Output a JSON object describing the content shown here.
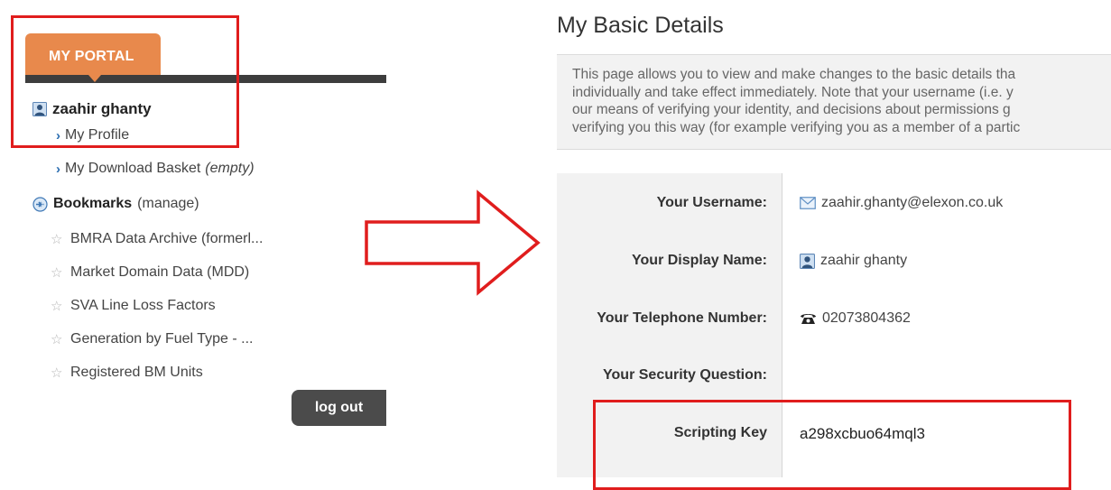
{
  "portal": {
    "tab_label": "MY PORTAL",
    "user_name": "zaahir ghanty",
    "profile_link": "My Profile",
    "download_basket_link": "My Download Basket",
    "download_basket_status": "(empty)",
    "bookmarks_title": "Bookmarks",
    "bookmarks_manage": "(manage)",
    "bookmarks": [
      "BMRA Data Archive (formerl...",
      "Market Domain Data (MDD)",
      "SVA Line Loss Factors",
      "Generation by Fuel Type - ...",
      "Registered BM Units"
    ],
    "logout_label": "log out"
  },
  "details": {
    "title": "My Basic Details",
    "intro_lines": [
      "This page allows you to view and make changes to the basic details tha",
      "individually and take effect immediately. Note that your username (i.e. y",
      "our means of verifying your identity, and decisions about permissions g",
      "verifying you this way (for example verifying you as a member of a partic"
    ],
    "username_label": "Your Username:",
    "username_value": "zaahir.ghanty@elexon.co.uk",
    "display_name_label": "Your Display Name:",
    "display_name_value": "zaahir ghanty",
    "telephone_label": "Your Telephone Number:",
    "telephone_value": "02073804362",
    "security_question_label": "Your Security Question:",
    "scripting_key_label": "Scripting Key",
    "scripting_key_value": "a298xcbuo64mql3"
  },
  "colors": {
    "accent_orange": "#e8894c",
    "highlight_red": "#e01d1d",
    "dark_bar": "#3d3d3d",
    "link_blue": "#2a6db0"
  },
  "icons": {
    "user": "user-icon",
    "bookmarks": "bookmarks-icon",
    "star": "star-outline-icon",
    "chevron": "chevron-right-icon",
    "email": "envelope-icon",
    "display_name": "user-icon",
    "telephone": "telephone-icon",
    "arrow": "right-arrow-icon"
  }
}
